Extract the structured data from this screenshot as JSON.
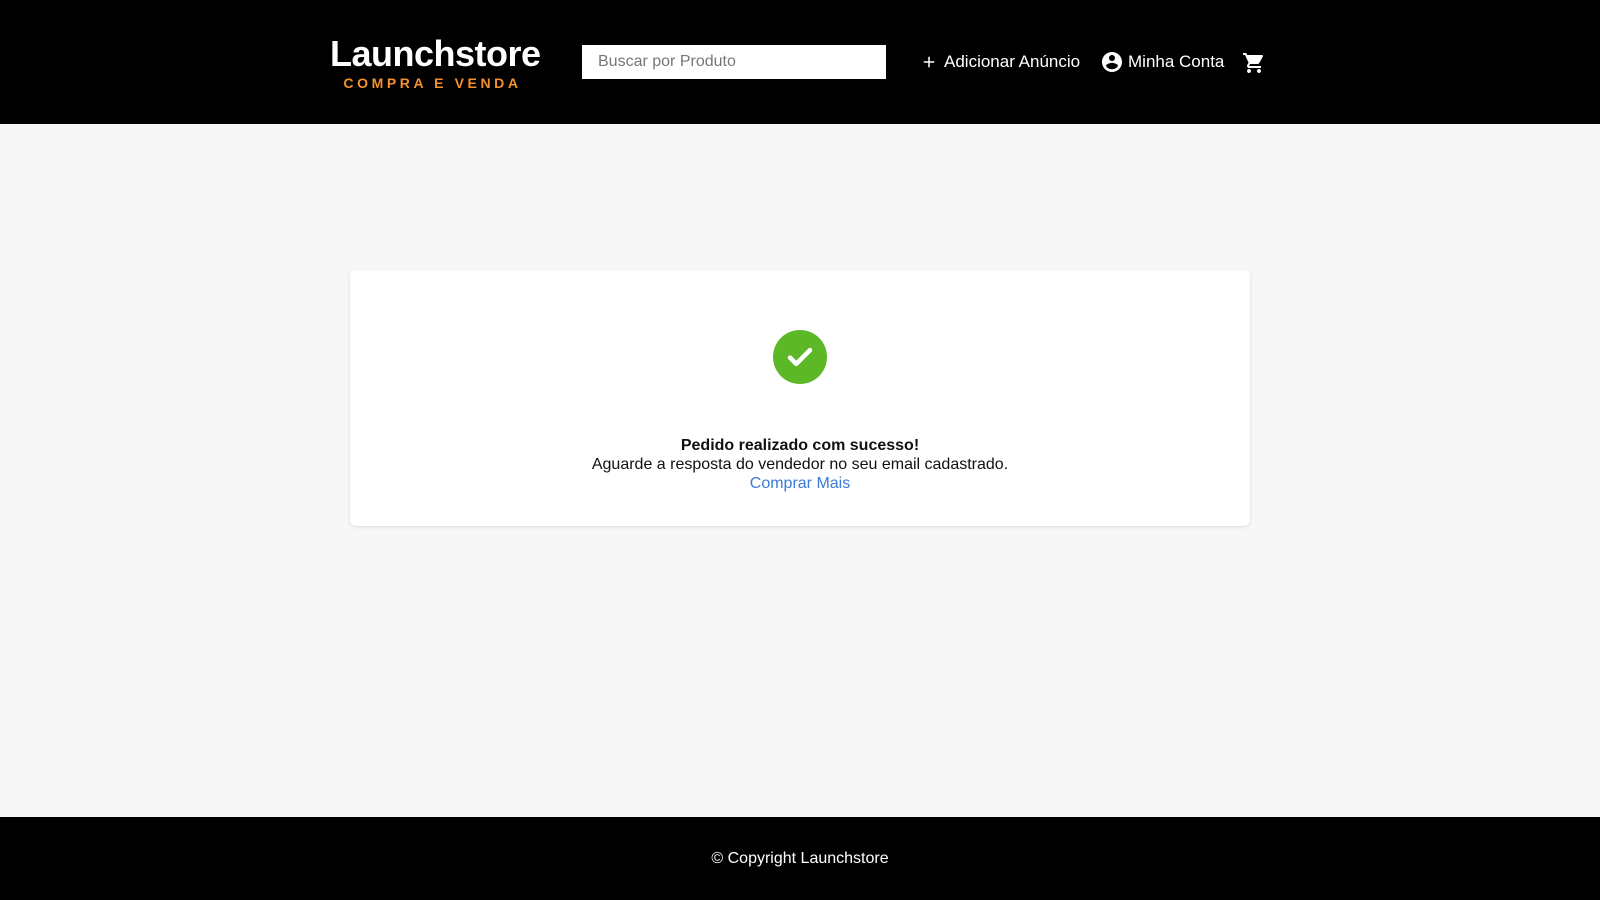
{
  "header": {
    "logo_title": "Launchstore",
    "logo_subtitle": "COMPRA E VENDA",
    "search_placeholder": "Buscar por Produto",
    "nav": {
      "add_label": "Adicionar Anúncio",
      "add_icon": "plus-icon",
      "account_label": "Minha Conta",
      "account_icon": "account-circle-icon",
      "cart_icon": "shopping-cart-icon"
    }
  },
  "main": {
    "status_icon": "check-circle-icon",
    "title": "Pedido realizado com sucesso!",
    "message": "Aguarde a resposta do vendedor no seu email cadastrado.",
    "link_label": "Comprar Mais"
  },
  "footer": {
    "copyright": "© Copyright Launchstore"
  },
  "colors": {
    "header_bg": "#000000",
    "accent_orange": "#f5902a",
    "success_green": "#5cb826",
    "link_blue": "#3a7bd5",
    "page_bg": "#f7f7f7"
  }
}
